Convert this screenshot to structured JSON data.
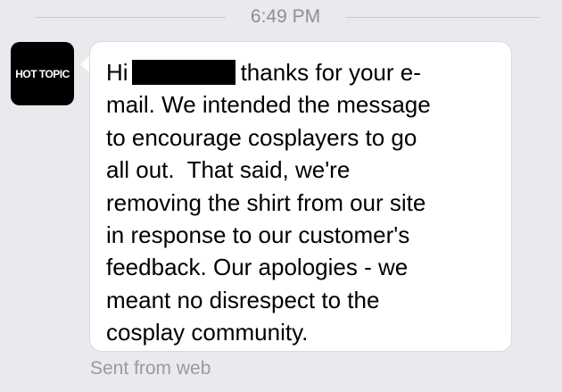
{
  "timestamp": "6:49 PM",
  "sender": {
    "avatar_logo_text": "HOT TOPIC",
    "avatar_bg_color": "#000000"
  },
  "message": {
    "greeting": "Hi",
    "redacted_name": "",
    "after_redaction": "thanks for your e-",
    "body": "mail. We intended the message\nto encourage cosplayers to go\nall out.  That said, we're\nremoving the shirt from our site\nin response to our customer's\nfeedback. Our apologies - we\nmeant no disrespect to the\ncosplay community."
  },
  "footer": {
    "sent_via": "Sent from web"
  },
  "colors": {
    "background": "#e9e9ee",
    "bubble": "#ffffff",
    "secondary_text": "#8e8e93",
    "redaction": "#000000"
  }
}
